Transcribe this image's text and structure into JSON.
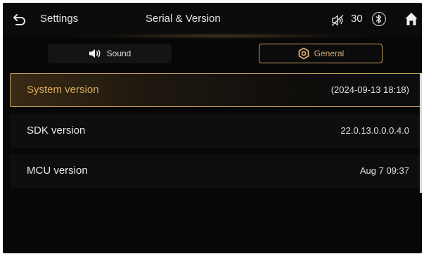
{
  "header": {
    "section_title": "Settings",
    "page_title": "Serial & Version",
    "volume_level": "30",
    "icons": [
      "back-icon",
      "volume-mute-icon",
      "bluetooth-icon",
      "home-icon"
    ]
  },
  "tabs": [
    {
      "label": "Sound",
      "icon": "speaker-icon",
      "selected": false
    },
    {
      "label": "General",
      "icon": "gear-icon",
      "selected": true
    }
  ],
  "version_list": [
    {
      "label": "System version",
      "value": "(2024-09-13 18:18)",
      "selected": true
    },
    {
      "label": "SDK version",
      "value": "22.0.13.0.0.0.4.0",
      "selected": false
    },
    {
      "label": "MCU version",
      "value": "Aug 7 09:37",
      "selected": false
    }
  ],
  "colors": {
    "accent": "#d9aa5e",
    "accent_border": "#bf9a5a",
    "background": "#070707",
    "text": "#e8e8e8"
  }
}
